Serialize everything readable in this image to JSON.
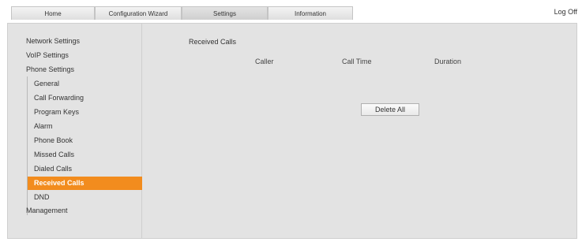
{
  "tabs": [
    {
      "label": "Home"
    },
    {
      "label": "Configuration Wizard"
    },
    {
      "label": "Settings"
    },
    {
      "label": "Information"
    }
  ],
  "logoff_label": "Log Off",
  "sidebar": {
    "network_settings": "Network Settings",
    "voip_settings": "VoIP Settings",
    "phone_settings": "Phone Settings",
    "phone_items": [
      {
        "label": "General"
      },
      {
        "label": "Call Forwarding"
      },
      {
        "label": "Program Keys"
      },
      {
        "label": "Alarm"
      },
      {
        "label": "Phone Book"
      },
      {
        "label": "Missed Calls"
      },
      {
        "label": "Dialed Calls"
      },
      {
        "label": "Received Calls"
      },
      {
        "label": "DND"
      }
    ],
    "management": "Management"
  },
  "main": {
    "title": "Received Calls",
    "columns": {
      "caller": "Caller",
      "call_time": "Call Time",
      "duration": "Duration"
    },
    "delete_all_label": "Delete All"
  },
  "colors": {
    "accent": "#f28c1e",
    "panel_bg": "#e3e3e3"
  }
}
